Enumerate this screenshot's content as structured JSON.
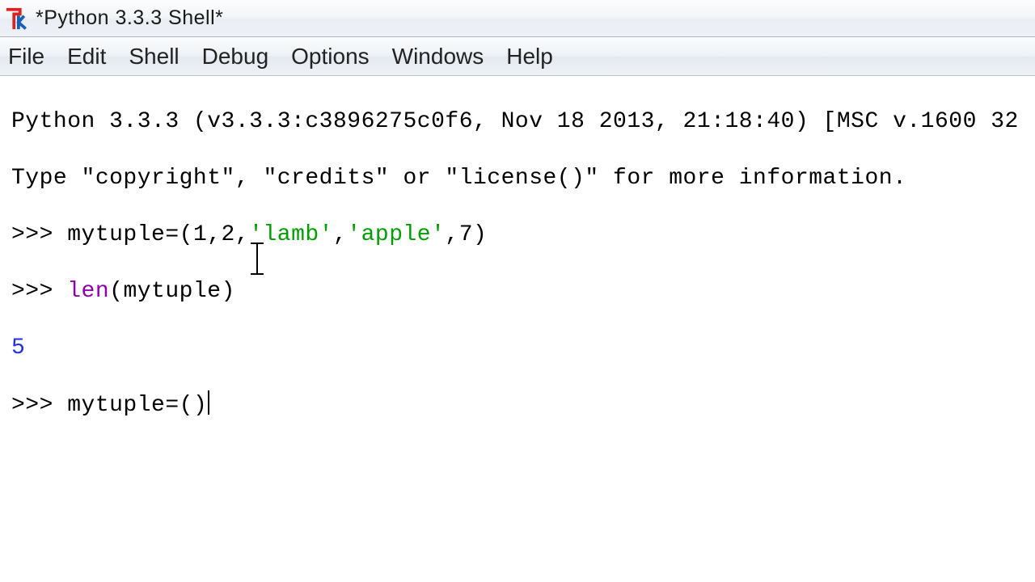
{
  "window": {
    "title": "*Python 3.3.3 Shell*"
  },
  "menu": {
    "file": "File",
    "edit": "Edit",
    "shell": "Shell",
    "debug": "Debug",
    "options": "Options",
    "windows": "Windows",
    "help": "Help"
  },
  "shell": {
    "banner1": "Python 3.3.3 (v3.3.3:c3896275c0f6, Nov 18 2013, 21:18:40) [MSC v.1600 32",
    "banner2": "Type \"copyright\", \"credits\" or \"license()\" for more information.",
    "prompt": ">>> ",
    "line1_a": "mytuple=(1,2,",
    "line1_s1": "'lamb'",
    "line1_b": ",",
    "line1_s2": "'apple'",
    "line1_c": ",7)",
    "line2_fn": "len",
    "line2_rest": "(mytuple)",
    "result": "5",
    "line3": "mytuple=()"
  }
}
